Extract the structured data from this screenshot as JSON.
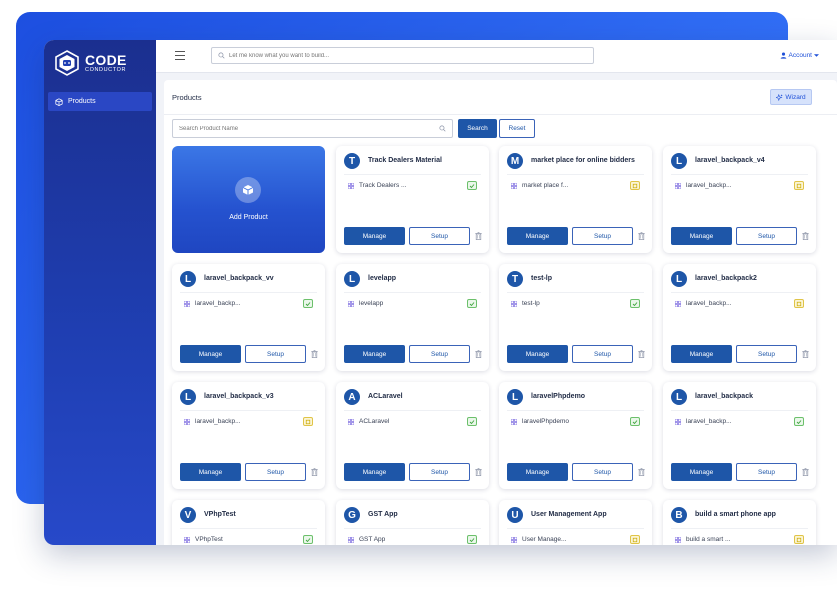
{
  "app": {
    "logo_main": "CODE",
    "logo_sub": "CONDUCTOR"
  },
  "sidebar": {
    "items": [
      {
        "label": "Products",
        "icon": "box-icon"
      }
    ]
  },
  "topbar": {
    "search_placeholder": "Let me know what you want to build...",
    "account_label": "Account"
  },
  "page": {
    "title": "Products",
    "wizard_label": "Wizard",
    "search_placeholder": "Search Product Name",
    "search_button": "Search",
    "reset_button": "Reset",
    "add_product_label": "Add Product",
    "manage_label": "Manage",
    "setup_label": "Setup"
  },
  "products": [
    {
      "initial": "T",
      "name": "Track Dealers Material",
      "item": "Track Dealers ...",
      "status": "ok"
    },
    {
      "initial": "M",
      "name": "market place for online bidders",
      "item": "market place f...",
      "status": "pending"
    },
    {
      "initial": "L",
      "name": "laravel_backpack_v4",
      "item": "laravel_backp...",
      "status": "pending"
    },
    {
      "initial": "L",
      "name": "laravel_backpack_vv",
      "item": "laravel_backp...",
      "status": "ok"
    },
    {
      "initial": "L",
      "name": "levelapp",
      "item": "levelapp",
      "status": "ok"
    },
    {
      "initial": "T",
      "name": "test-lp",
      "item": "test-lp",
      "status": "ok"
    },
    {
      "initial": "L",
      "name": "laravel_backpack2",
      "item": "laravel_backp...",
      "status": "pending"
    },
    {
      "initial": "L",
      "name": "laravel_backpack_v3",
      "item": "laravel_backp...",
      "status": "pending"
    },
    {
      "initial": "A",
      "name": "ACLaravel",
      "item": "ACLaravel",
      "status": "ok"
    },
    {
      "initial": "L",
      "name": "laravelPhpdemo",
      "item": "laravelPhpdemo",
      "status": "ok"
    },
    {
      "initial": "L",
      "name": "laravel_backpack",
      "item": "laravel_backp...",
      "status": "ok"
    },
    {
      "initial": "V",
      "name": "VPhpTest",
      "item": "VPhpTest",
      "status": "ok"
    },
    {
      "initial": "G",
      "name": "GST App",
      "item": "GST App",
      "status": "ok"
    },
    {
      "initial": "U",
      "name": "User Management App",
      "item": "User Manage...",
      "status": "pending"
    },
    {
      "initial": "B",
      "name": "build a smart phone app",
      "item": "build a smart ...",
      "status": "pending"
    }
  ],
  "colors": {
    "primary": "#1e56a8",
    "sidebar": "#1f3fb3",
    "backdrop": "#2f6bf3",
    "ok": "#6cc06b",
    "pending": "#e0c447"
  }
}
